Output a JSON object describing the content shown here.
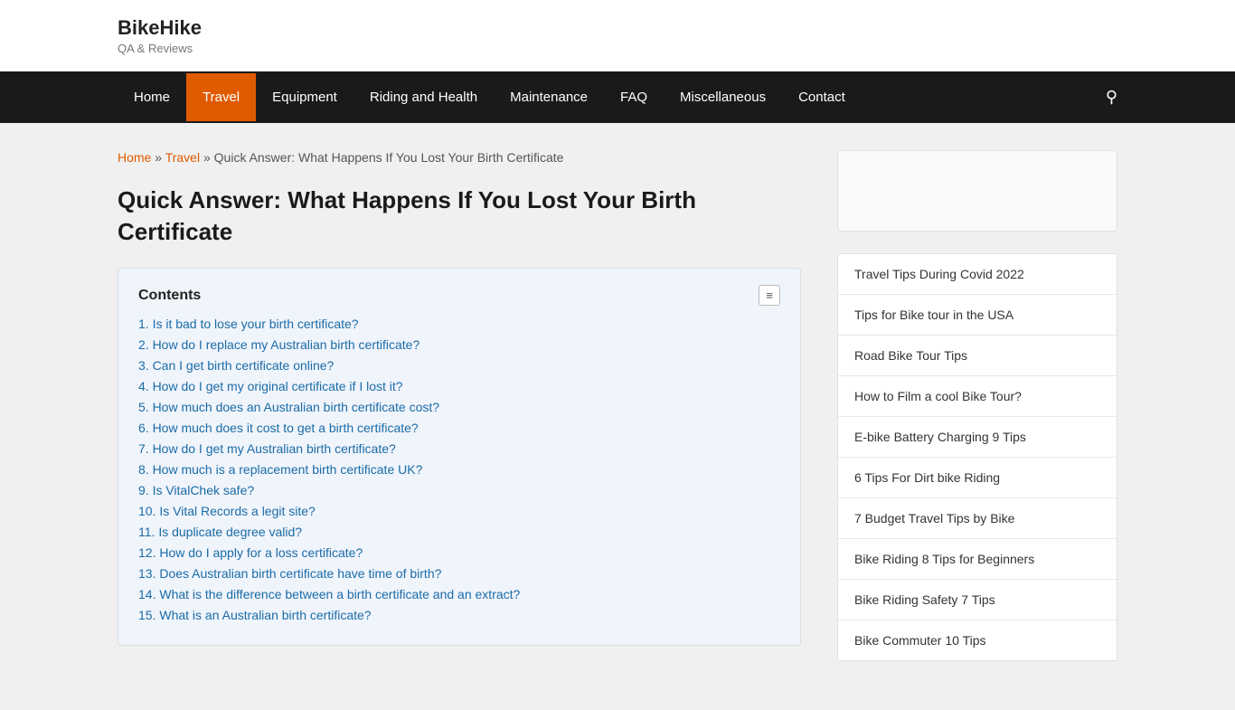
{
  "site": {
    "title": "BikeHike",
    "subtitle": "QA & Reviews"
  },
  "nav": {
    "items": [
      {
        "label": "Home",
        "active": false
      },
      {
        "label": "Travel",
        "active": true
      },
      {
        "label": "Equipment",
        "active": false
      },
      {
        "label": "Riding and Health",
        "active": false
      },
      {
        "label": "Maintenance",
        "active": false
      },
      {
        "label": "FAQ",
        "active": false
      },
      {
        "label": "Miscellaneous",
        "active": false
      },
      {
        "label": "Contact",
        "active": false
      }
    ]
  },
  "breadcrumb": {
    "home": "Home",
    "travel": "Travel",
    "current": "Quick Answer: What Happens If You Lost Your Birth Certificate"
  },
  "article": {
    "title": "Quick Answer: What Happens If You Lost Your Birth Certificate",
    "contents": {
      "heading": "Contents",
      "toggle_label": "≡",
      "items": [
        {
          "num": "1.",
          "text": "Is it bad to lose your birth certificate?"
        },
        {
          "num": "2.",
          "text": "How do I replace my Australian birth certificate?"
        },
        {
          "num": "3.",
          "text": "Can I get birth certificate online?"
        },
        {
          "num": "4.",
          "text": "How do I get my original certificate if I lost it?"
        },
        {
          "num": "5.",
          "text": "How much does an Australian birth certificate cost?"
        },
        {
          "num": "6.",
          "text": "How much does it cost to get a birth certificate?"
        },
        {
          "num": "7.",
          "text": "How do I get my Australian birth certificate?"
        },
        {
          "num": "8.",
          "text": "How much is a replacement birth certificate UK?"
        },
        {
          "num": "9.",
          "text": "Is VitalChek safe?"
        },
        {
          "num": "10.",
          "text": "Is Vital Records a legit site?"
        },
        {
          "num": "11.",
          "text": "Is duplicate degree valid?"
        },
        {
          "num": "12.",
          "text": "How do I apply for a loss certificate?"
        },
        {
          "num": "13.",
          "text": "Does Australian birth certificate have time of birth?"
        },
        {
          "num": "14.",
          "text": "What is the difference between a birth certificate and an extract?"
        },
        {
          "num": "15.",
          "text": "What is an Australian birth certificate?"
        }
      ]
    }
  },
  "sidebar": {
    "links": [
      {
        "text": "Travel Tips During Covid 2022"
      },
      {
        "text": "Tips for Bike tour in the USA"
      },
      {
        "text": "Road Bike Tour Tips"
      },
      {
        "text": "How to Film a cool Bike Tour?"
      },
      {
        "text": "E-bike Battery Charging 9 Tips"
      },
      {
        "text": "6 Tips For Dirt bike Riding"
      },
      {
        "text": "7 Budget Travel Tips by Bike"
      },
      {
        "text": "Bike Riding 8 Tips for Beginners"
      },
      {
        "text": "Bike Riding Safety 7 Tips"
      },
      {
        "text": "Bike Commuter 10 Tips"
      }
    ]
  }
}
